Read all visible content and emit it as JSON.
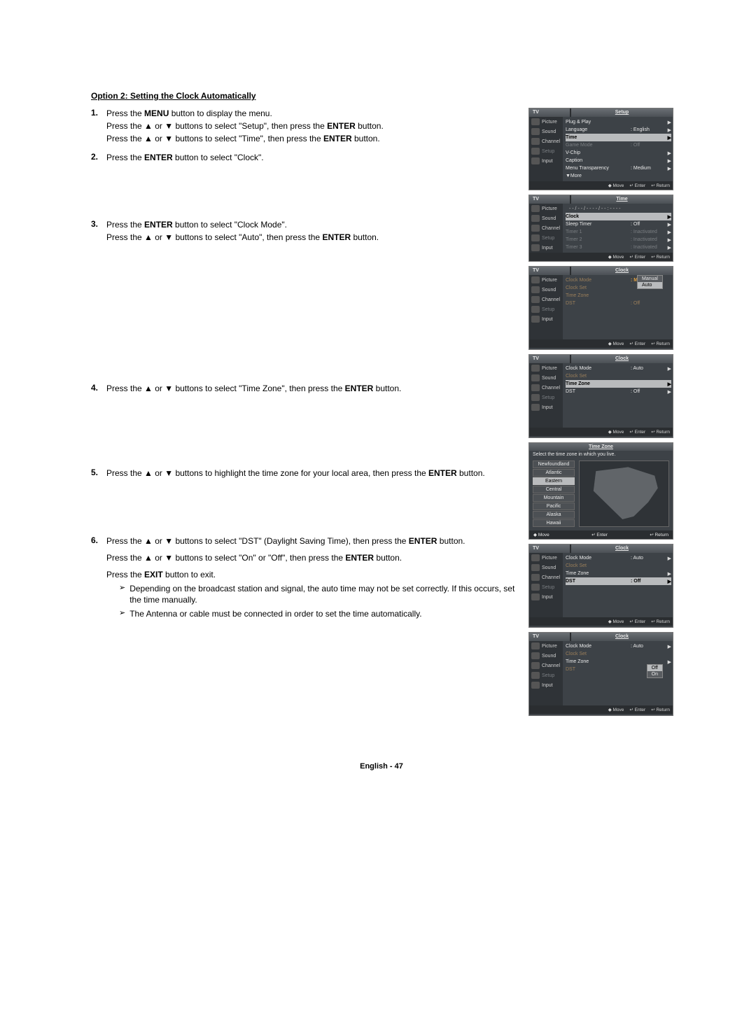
{
  "title": "Option 2: Setting the Clock Automatically",
  "steps": {
    "s1n": "1.",
    "s1a": "Press the ",
    "s1b": "MENU",
    "s1c": " button to display the menu.",
    "s1d": "Press the ▲ or ▼ buttons to select \"Setup\", then press the ",
    "s1e": "ENTER",
    "s1f": " button.",
    "s1g": "Press the ▲ or ▼ buttons to select \"Time\", then press the ",
    "s1h": "ENTER",
    "s1i": " button.",
    "s2n": "2.",
    "s2a": "Press the ",
    "s2b": "ENTER",
    "s2c": " button to select \"Clock\".",
    "s3n": "3.",
    "s3a": "Press the ",
    "s3b": "ENTER",
    "s3c": " button to select \"Clock Mode\".",
    "s3d": "Press the ▲ or ▼ buttons to select \"Auto\", then press the ",
    "s3e": "ENTER",
    "s3f": " button.",
    "s4n": "4.",
    "s4a": "Press the ▲ or ▼ buttons to select \"Time Zone\", then press the ",
    "s4b": "ENTER",
    "s4c": " button.",
    "s5n": "5.",
    "s5a": "Press the ▲ or ▼ buttons to highlight the time zone for your local area, then press the ",
    "s5b": "ENTER",
    "s5c": " button.",
    "s6n": "6.",
    "s6a": "Press the ▲ or ▼ buttons to select \"DST\" (Daylight Saving Time), then press the ",
    "s6b": "ENTER",
    "s6c": " button.",
    "s6d": "Press the ▲ or ▼ buttons to select \"On\" or \"Off\", then press the ",
    "s6e": "ENTER",
    "s6f": " button.",
    "s6g": "Press the ",
    "s6h": "EXIT",
    "s6i": " button to exit.",
    "note1": "Depending on the broadcast station and signal, the auto time may not be set correctly. If this occurs, set the time manually.",
    "note2": "The Antenna or cable must be connected in order to set the time automatically.",
    "noteIcon": "➢"
  },
  "osd": {
    "tv": "TV",
    "side": {
      "picture": "Picture",
      "sound": "Sound",
      "channel": "Channel",
      "setup": "Setup",
      "input": "Input"
    },
    "foot": {
      "move": "Move",
      "enter": "Enter",
      "return": "Return",
      "updown": "◆",
      "enterIco": "↵",
      "retIco": "↩"
    },
    "arrow": "▶",
    "m1": {
      "title": "Setup",
      "r1": {
        "l": "Plug & Play"
      },
      "r2": {
        "l": "Language",
        "v": ": English"
      },
      "r3": {
        "l": "Time"
      },
      "r4": {
        "l": "Game Mode",
        "v": ": Off"
      },
      "r5": {
        "l": "V-Chip"
      },
      "r6": {
        "l": "Caption"
      },
      "r7": {
        "l": "Menu Transparency",
        "v": ": Medium"
      },
      "r8": {
        "l": "▼More"
      }
    },
    "m2": {
      "title": "Time",
      "clockline": "- - / - - / - - - - / - -  :  - -  - -",
      "r1": {
        "l": "Clock"
      },
      "r2": {
        "l": "Sleep Timer",
        "v": ": Off"
      },
      "r3": {
        "l": "Timer 1",
        "v": ": Inactivated"
      },
      "r4": {
        "l": "Timer 2",
        "v": ": Inactivated"
      },
      "r5": {
        "l": "Timer 3",
        "v": ": Inactivated"
      }
    },
    "m3": {
      "title": "Clock",
      "r1": {
        "l": "Clock Mode",
        "v": ": Manual"
      },
      "r2": {
        "l": "Clock Set"
      },
      "r3": {
        "l": "Time Zone"
      },
      "r4": {
        "l": "DST",
        "v": ": Off"
      },
      "opt1": "Manual",
      "opt2": "Auto"
    },
    "m4": {
      "title": "Clock",
      "r1": {
        "l": "Clock Mode",
        "v": ": Auto"
      },
      "r2": {
        "l": "Clock Set"
      },
      "r3": {
        "l": "Time Zone"
      },
      "r4": {
        "l": "DST",
        "v": ": Off"
      }
    },
    "m5": {
      "title": "Time Zone",
      "sub": "Select the time zone in which you live.",
      "items": [
        "Newfoundland",
        "Atlantic",
        "Eastern",
        "Central",
        "Mountain",
        "Pacific",
        "Alaska",
        "Hawaii"
      ],
      "selected": "Eastern"
    },
    "m6": {
      "title": "Clock",
      "r1": {
        "l": "Clock Mode",
        "v": ": Auto"
      },
      "r2": {
        "l": "Clock Set"
      },
      "r3": {
        "l": "Time Zone"
      },
      "r4": {
        "l": "DST",
        "v": ": Off"
      }
    },
    "m7": {
      "title": "Clock",
      "r1": {
        "l": "Clock Mode",
        "v": ": Auto"
      },
      "r2": {
        "l": "Clock Set"
      },
      "r3": {
        "l": "Time Zone"
      },
      "r4": {
        "l": "DST"
      },
      "opt1": "Off",
      "opt2": "On"
    }
  },
  "footer": "English - 47"
}
